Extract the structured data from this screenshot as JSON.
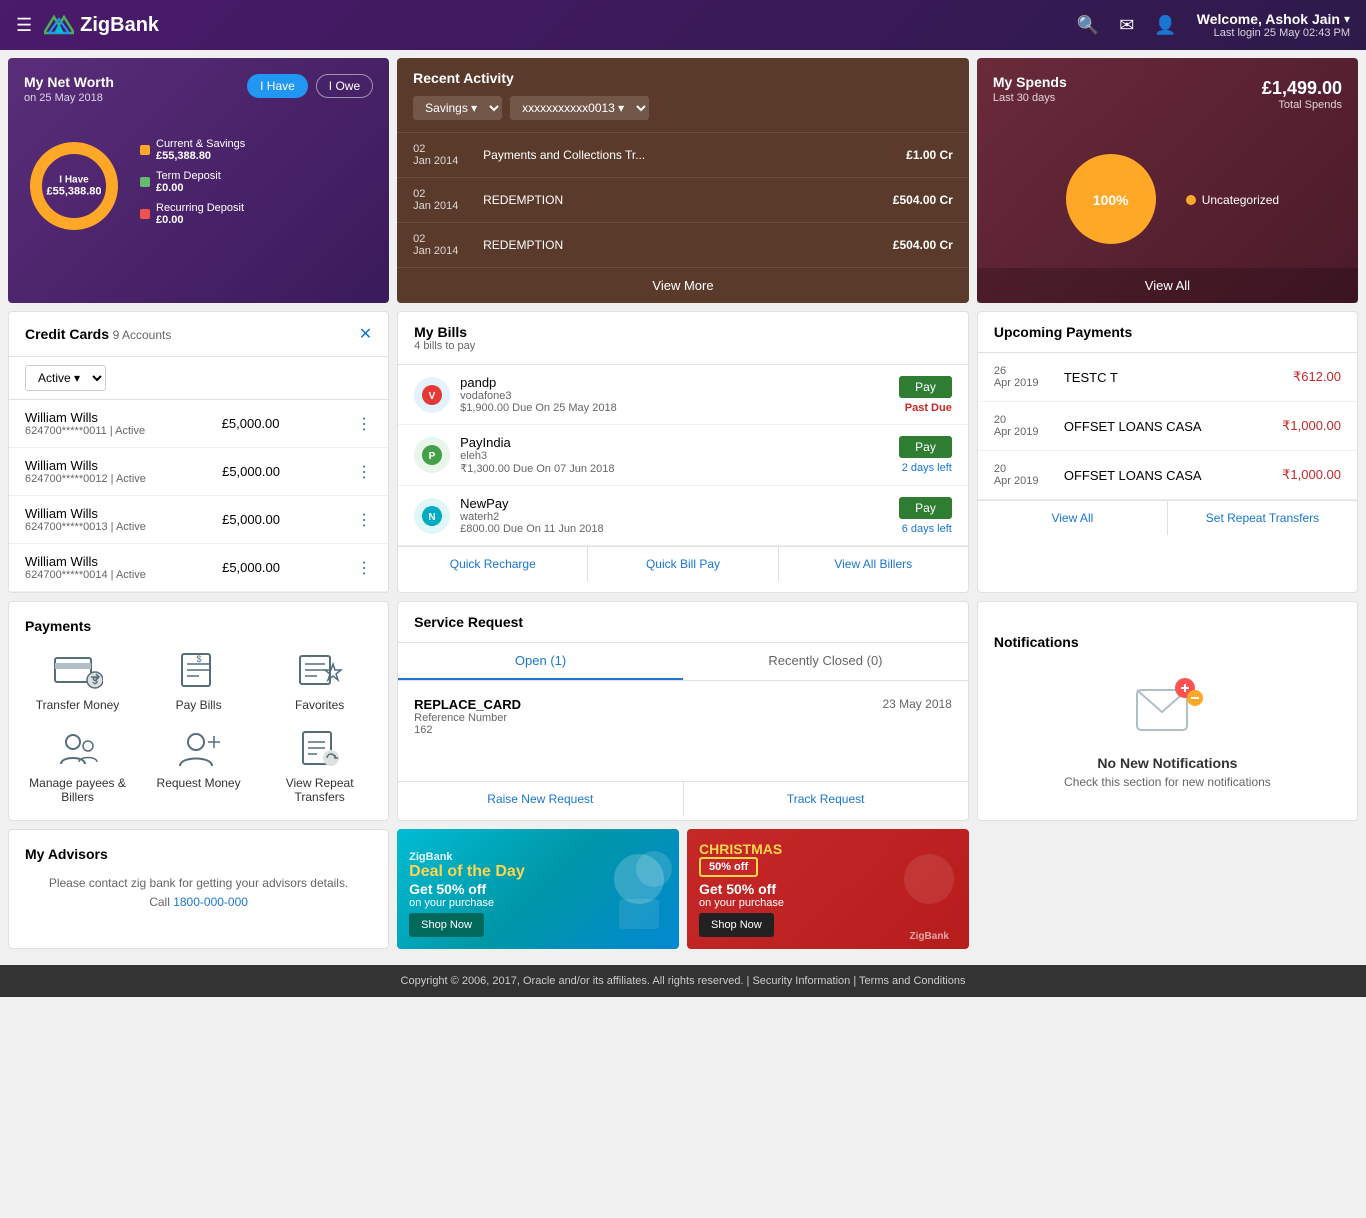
{
  "header": {
    "hamburger": "☰",
    "logo_text": "ZigBank",
    "search_icon": "🔍",
    "mail_icon": "✉",
    "user_icon": "👤",
    "welcome_text": "Welcome, Ashok Jain",
    "last_login": "Last login 25 May 02:43 PM",
    "chevron": "▾"
  },
  "net_worth": {
    "title": "My Net Worth",
    "subtitle": "on 25 May 2018",
    "i_have_label": "I Have",
    "i_owe_label": "I Owe",
    "center_label": "I Have",
    "center_amount": "£55,388.80",
    "legend": [
      {
        "color": "#FFA726",
        "label": "Current & Savings",
        "amount": "£55,388.80"
      },
      {
        "color": "#66BB6A",
        "label": "Term Deposit",
        "amount": "£0.00"
      },
      {
        "color": "#EF5350",
        "label": "Recurring Deposit",
        "amount": "£0.00"
      }
    ]
  },
  "recent_activity": {
    "title": "Recent Activity",
    "savings_label": "Savings",
    "account_number": "xxxxxxxxxxx0013",
    "rows": [
      {
        "date": "02 Jan 2014",
        "desc": "Payments and Collections Tr...",
        "amount": "£1.00 Cr"
      },
      {
        "date": "02 Jan 2014",
        "desc": "REDEMPTION",
        "amount": "£504.00 Cr"
      },
      {
        "date": "02 Jan 2014",
        "desc": "REDEMPTION",
        "amount": "£504.00 Cr"
      }
    ],
    "view_more": "View More"
  },
  "my_spends": {
    "title": "My Spends",
    "subtitle": "Last 30 days",
    "total_amount": "£1,499.00",
    "total_label": "Total Spends",
    "percent": "100%",
    "legend_color": "#FFA726",
    "legend_label": "Uncategorized",
    "view_all": "View All"
  },
  "credit_cards": {
    "title": "Credit Cards",
    "count": "9 Accounts",
    "filter_label": "Active",
    "close_icon": "✕",
    "cards": [
      {
        "name": "William Wills",
        "number": "624700*****0011 | Active",
        "amount": "£5,000.00"
      },
      {
        "name": "William Wills",
        "number": "624700*****0012 | Active",
        "amount": "£5,000.00"
      },
      {
        "name": "William Wills",
        "number": "624700*****0013 | Active",
        "amount": "£5,000.00"
      },
      {
        "name": "William Wills",
        "number": "624700*****0014 | Active",
        "amount": "£5,000.00"
      }
    ]
  },
  "my_bills": {
    "title": "My Bills",
    "subtitle": "4 bills to pay",
    "bills": [
      {
        "name": "pandp",
        "sub": "vodafone3",
        "amount": "$1,900.00",
        "due": "Due On 25 May 2018",
        "status": "Past Due",
        "status_color": "#c62828"
      },
      {
        "name": "PayIndia",
        "sub": "eleh3",
        "amount": "₹1,300.00",
        "due": "Due On 07 Jun 2018",
        "status": "2 days left",
        "status_color": "#1976D2"
      },
      {
        "name": "NewPay",
        "sub": "waterh2",
        "amount": "£800.00",
        "due": "Due On 11 Jun 2018",
        "status": "6 days left",
        "status_color": "#1976D2"
      }
    ],
    "pay_label": "Pay",
    "footer": {
      "quick_recharge": "Quick Recharge",
      "quick_bill_pay": "Quick Bill Pay",
      "view_all_billers": "View All Billers"
    }
  },
  "upcoming_payments": {
    "title": "Upcoming Payments",
    "items": [
      {
        "date": "26 Apr 2019",
        "name": "TESTC T",
        "amount": "₹612.00"
      },
      {
        "date": "20 Apr 2019",
        "name": "OFFSET LOANS CASA",
        "amount": "₹1,000.00"
      },
      {
        "date": "20 Apr 2019",
        "name": "OFFSET LOANS CASA",
        "amount": "₹1,000.00"
      }
    ],
    "footer": {
      "view_all": "View All",
      "set_repeat": "Set Repeat Transfers"
    }
  },
  "payments": {
    "title": "Payments",
    "items": [
      {
        "label": "Transfer Money",
        "icon": "transfer"
      },
      {
        "label": "Pay Bills",
        "icon": "bills"
      },
      {
        "label": "Favorites",
        "icon": "favorites"
      },
      {
        "label": "Manage payees & Billers",
        "icon": "payees"
      },
      {
        "label": "Request Money",
        "icon": "request"
      },
      {
        "label": "View Repeat Transfers",
        "icon": "repeat"
      }
    ]
  },
  "service_request": {
    "title": "Service Request",
    "tab_open": "Open (1)",
    "tab_closed": "Recently Closed (0)",
    "item": {
      "type": "REPLACE_CARD",
      "ref_label": "Reference Number",
      "ref_number": "162",
      "date": "23 May 2018"
    },
    "raise_btn": "Raise New Request",
    "track_btn": "Track Request"
  },
  "notifications": {
    "title": "Notifications",
    "empty_text": "No New Notifications",
    "sub_text": "Check this section for new notifications"
  },
  "my_advisors": {
    "title": "My Advisors",
    "text": "Please contact zig bank for getting your advisors details.",
    "call_label": "Call",
    "phone": "1800-000-000"
  },
  "promo_blue": {
    "brand": "ZigBank",
    "deal": "Deal of the Day",
    "text": "Get 50% off",
    "subtext": "on your purchase",
    "btn": "Shop Now"
  },
  "promo_red": {
    "season": "CHRISTMAS",
    "off_badge": "50% off",
    "text": "Get 50% off",
    "subtext": "on your purchase",
    "btn": "Shop Now",
    "brand": "ZigBank"
  },
  "footer": {
    "text": "Copyright © 2006, 2017, Oracle and/or its affiliates. All rights reserved. | Security Information | Terms and Conditions"
  }
}
